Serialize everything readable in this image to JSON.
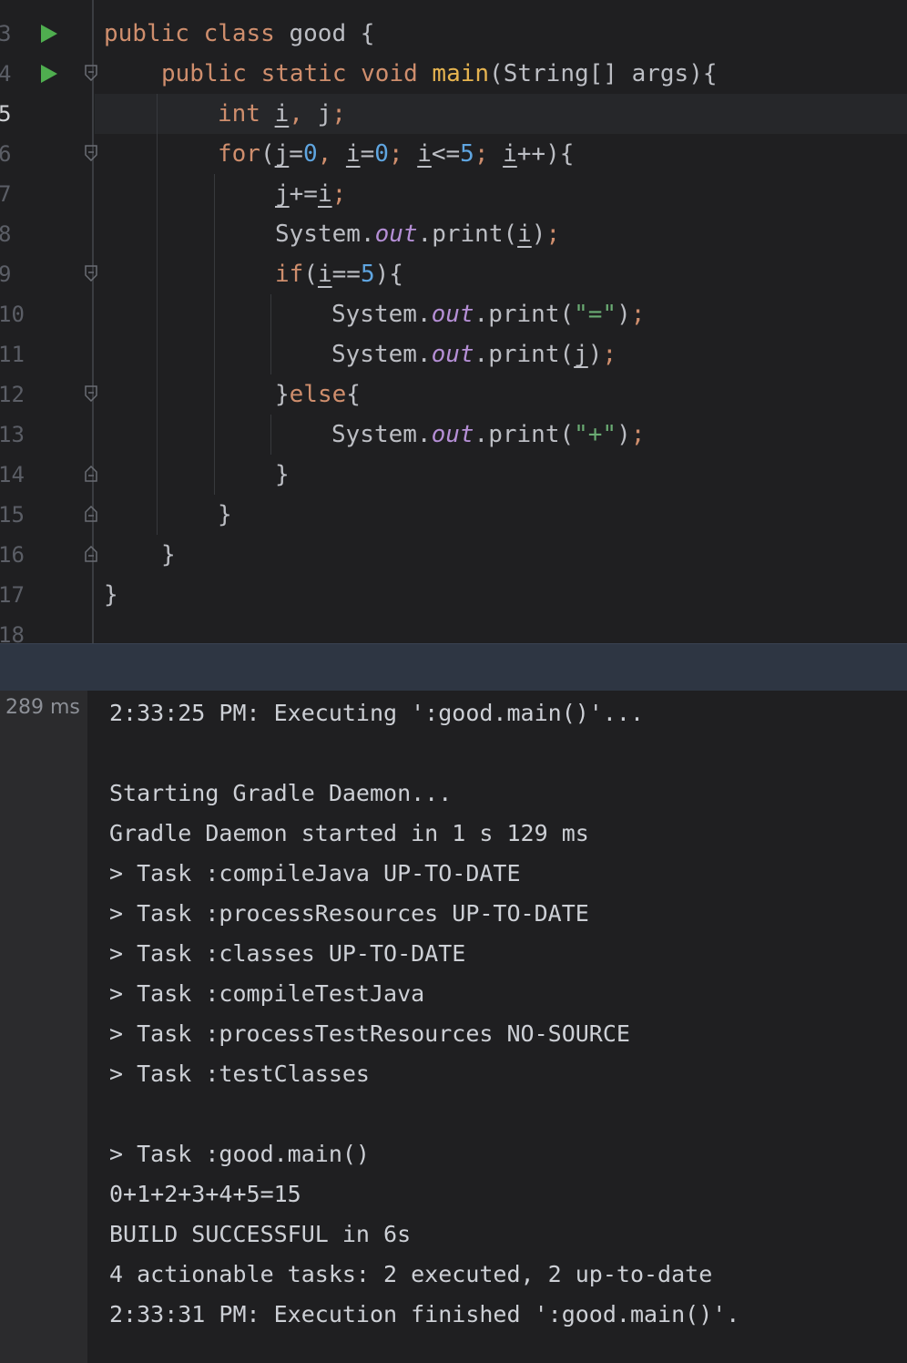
{
  "editor": {
    "line_numbers": [
      "3",
      "4",
      "5",
      "6",
      "7",
      "8",
      "9",
      "10",
      "11",
      "12",
      "13",
      "14",
      "15",
      "16",
      "17",
      "18"
    ],
    "current_line": "5"
  },
  "console": {
    "elapsed": "289 ms",
    "lines": [
      "2:33:25 PM: Executing ':good.main()'...",
      "",
      "Starting Gradle Daemon...",
      "Gradle Daemon started in 1 s 129 ms",
      "> Task :compileJava UP-TO-DATE",
      "> Task :processResources UP-TO-DATE",
      "> Task :classes UP-TO-DATE",
      "> Task :compileTestJava",
      "> Task :processTestResources NO-SOURCE",
      "> Task :testClasses",
      "",
      "> Task :good.main()",
      "0+1+2+3+4+5=15",
      "BUILD SUCCESSFUL in 6s",
      "4 actionable tasks: 2 executed, 2 up-to-date",
      "2:33:31 PM: Execution finished ':good.main()'."
    ]
  },
  "colors": {
    "editor_bg": "#1f1f21",
    "keyword": "#cf8e6d",
    "number": "#5fa5e0",
    "string": "#6aab73",
    "field": "#b58fd6",
    "method": "#e6b450",
    "run_icon": "#4fae4f"
  },
  "icons": {
    "run": "run-icon",
    "fold": "fold-icon"
  }
}
